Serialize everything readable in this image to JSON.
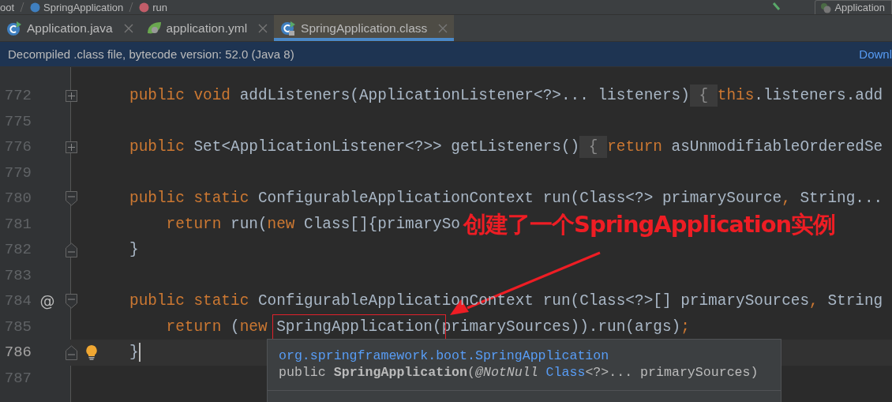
{
  "breadcrumbs": [
    {
      "label": "oot",
      "kind": "package"
    },
    {
      "label": "SpringApplication",
      "kind": "class"
    },
    {
      "label": "run",
      "kind": "method"
    }
  ],
  "run_config": {
    "label": "Application"
  },
  "tabs": [
    {
      "label": "Application.java",
      "kind": "java",
      "selected": false
    },
    {
      "label": "application.yml",
      "kind": "yml",
      "selected": false
    },
    {
      "label": "SpringApplication.class",
      "kind": "class",
      "selected": true
    }
  ],
  "banner": {
    "text": "Decompiled .class file, bytecode version: 52.0 (Java 8)",
    "link": "Downl"
  },
  "lines": [
    {
      "number": "772",
      "current": false,
      "kind": "expand",
      "tokens": [
        {
          "text": "public void ",
          "kind": "keyword"
        },
        {
          "text": "addListeners(ApplicationListener<?>... listeners)",
          "kind": "plain"
        },
        {
          "text": " { ",
          "kind": "folded"
        },
        {
          "text": "this",
          "kind": "keyword"
        },
        {
          "text": ".listeners.add",
          "kind": "plain"
        }
      ]
    },
    {
      "number": "775",
      "current": false,
      "kind": "plain"
    },
    {
      "number": "776",
      "current": false,
      "kind": "expand",
      "tokens": [
        {
          "text": "public ",
          "kind": "keyword"
        },
        {
          "text": "Set<ApplicationListener<?>> getListeners()",
          "kind": "plain"
        },
        {
          "text": " { ",
          "kind": "folded"
        },
        {
          "text": "return ",
          "kind": "keyword"
        },
        {
          "text": "asUnmodifiableOrderedSe",
          "kind": "plain"
        }
      ]
    },
    {
      "number": "779",
      "current": false,
      "kind": "plain"
    },
    {
      "number": "780",
      "current": false,
      "kind": "fold-start",
      "tokens": [
        {
          "text": "public static ",
          "kind": "keyword"
        },
        {
          "text": "ConfigurableApplicationContext run(Class<?> primarySource",
          "kind": "plain"
        },
        {
          "text": ", ",
          "kind": "punct"
        },
        {
          "text": "String...",
          "kind": "plain"
        }
      ]
    },
    {
      "number": "781",
      "current": false,
      "kind": "plain",
      "tokens": [
        {
          "text": "    return ",
          "kind": "keyword"
        },
        {
          "text": "run(",
          "kind": "plain"
        },
        {
          "text": "new ",
          "kind": "keyword"
        },
        {
          "text": "Class[]{primarySo",
          "kind": "plain"
        }
      ]
    },
    {
      "number": "782",
      "current": false,
      "kind": "fold-end",
      "tokens": [
        {
          "text": "}",
          "kind": "plain"
        }
      ]
    },
    {
      "number": "783",
      "current": false,
      "kind": "plain"
    },
    {
      "number": "784",
      "current": false,
      "kind": "fold-start",
      "marker": "@",
      "tokens": [
        {
          "text": "public static ",
          "kind": "keyword"
        },
        {
          "text": "ConfigurableApplicationContext run(Class<?>[] primarySources",
          "kind": "plain"
        },
        {
          "text": ", ",
          "kind": "punct"
        },
        {
          "text": "String",
          "kind": "plain"
        }
      ]
    },
    {
      "number": "785",
      "current": false,
      "kind": "plain",
      "tokens": [
        {
          "text": "    return ",
          "kind": "keyword"
        },
        {
          "text": "(",
          "kind": "plain"
        },
        {
          "text": "new ",
          "kind": "keyword"
        },
        {
          "text": "SpringApplication(",
          "kind": "plain",
          "boxed": true
        },
        {
          "text": "primarySources)).run(args)",
          "kind": "plain"
        },
        {
          "text": ";",
          "kind": "punct"
        }
      ]
    },
    {
      "number": "786",
      "current": true,
      "kind": "fold-end",
      "lightbulb": true,
      "tokens": [
        {
          "text": "}",
          "kind": "plain"
        }
      ]
    },
    {
      "number": "787",
      "current": false,
      "kind": "plain"
    }
  ],
  "tooltip": {
    "lines": [
      [
        {
          "text": "org.springframework.boot.SpringApplication",
          "kind": "type"
        }
      ],
      [
        {
          "text": "public ",
          "kind": "plain"
        },
        {
          "text": "SpringApplication",
          "kind": "bold"
        },
        {
          "text": "(",
          "kind": "plain"
        },
        {
          "text": "@NotNull ",
          "kind": "italic"
        },
        {
          "text": "Class",
          "kind": "type"
        },
        {
          "text": "<?>... primarySources)",
          "kind": "plain"
        }
      ]
    ]
  },
  "annotation": {
    "text": "创建了一个SpringApplication实例"
  }
}
